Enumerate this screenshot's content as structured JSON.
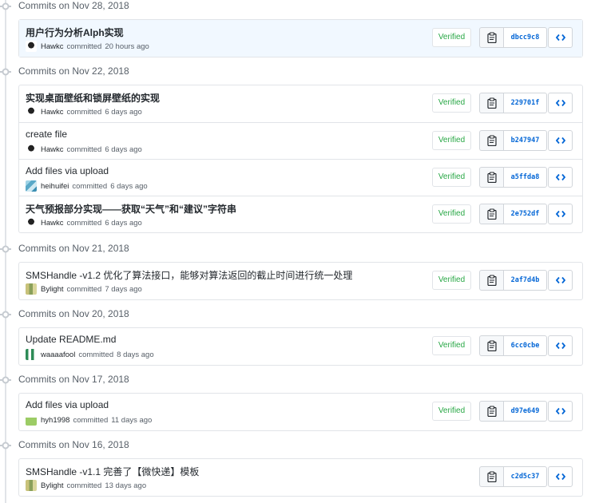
{
  "groups": [
    {
      "date": "Commits on Nov 28, 2018",
      "commits": [
        {
          "title": "用户行为分析Alph实现",
          "author": "Hawkc",
          "action": "committed",
          "time": "20 hours ago",
          "verified": "Verified",
          "sha": "dbcc9c8",
          "avatar": "hawkc",
          "highlight": true
        }
      ]
    },
    {
      "date": "Commits on Nov 22, 2018",
      "commits": [
        {
          "title": "实现桌面壁纸和锁屏壁纸的实现",
          "author": "Hawkc",
          "action": "committed",
          "time": "6 days ago",
          "verified": "Verified",
          "sha": "229701f",
          "avatar": "hawkc"
        },
        {
          "title": "create file",
          "author": "Hawkc",
          "action": "committed",
          "time": "6 days ago",
          "verified": "Verified",
          "sha": "b247947",
          "avatar": "hawkc"
        },
        {
          "title": "Add files via upload",
          "author": "heihuifei",
          "action": "committed",
          "time": "6 days ago",
          "verified": "Verified",
          "sha": "a5ffda8",
          "avatar": "heihuifei"
        },
        {
          "title": "天气预报部分实现——获取“天气”和“建议”字符串",
          "author": "Hawkc",
          "action": "committed",
          "time": "6 days ago",
          "verified": "Verified",
          "sha": "2e752df",
          "avatar": "hawkc"
        }
      ]
    },
    {
      "date": "Commits on Nov 21, 2018",
      "commits": [
        {
          "title": "SMSHandle -v1.2 优化了算法接口，能够对算法返回的截止时间进行统一处理",
          "author": "Bylight",
          "action": "committed",
          "time": "7 days ago",
          "verified": "Verified",
          "sha": "2af7d4b",
          "avatar": "bylight"
        }
      ]
    },
    {
      "date": "Commits on Nov 20, 2018",
      "commits": [
        {
          "title": "Update README.md",
          "author": "waaaafool",
          "action": "committed",
          "time": "8 days ago",
          "verified": "Verified",
          "sha": "6cc0cbe",
          "avatar": "waaaafool"
        }
      ]
    },
    {
      "date": "Commits on Nov 17, 2018",
      "commits": [
        {
          "title": "Add files via upload",
          "author": "hyh1998",
          "action": "committed",
          "time": "11 days ago",
          "verified": "Verified",
          "sha": "d97e649",
          "avatar": "hyh1998"
        }
      ]
    },
    {
      "date": "Commits on Nov 16, 2018",
      "commits": [
        {
          "title": "SMSHandle -v1.1 完善了【微快递】模板",
          "author": "Bylight",
          "action": "committed",
          "time": "13 days ago",
          "verified": "",
          "sha": "c2d5c37",
          "avatar": "bylight"
        }
      ]
    }
  ],
  "icons": {
    "commit_node": "git-commit-icon",
    "copy": "clippy-icon",
    "browse": "code-icon"
  },
  "colors": {
    "verified": "#28a745",
    "link": "#0366d6",
    "highlight_row": "#f1f8ff",
    "border": "#e1e4e8"
  }
}
